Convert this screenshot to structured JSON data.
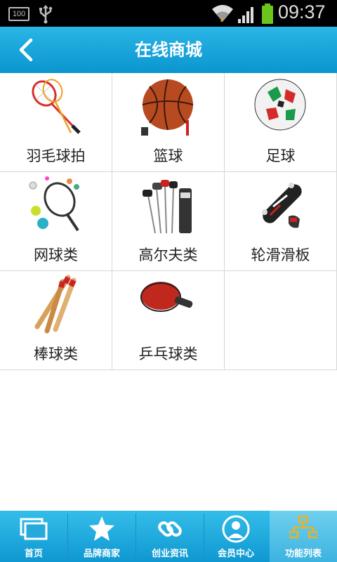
{
  "status_bar": {
    "battery_badge": "100",
    "time": "09:37",
    "icons": [
      "battery-100-icon",
      "usb-icon",
      "wifi-icon",
      "signal-icon",
      "battery-charging-icon"
    ]
  },
  "header": {
    "title": "在线商城",
    "back_icon": "back-arrow-icon"
  },
  "colors": {
    "header": "#13a1d8",
    "tabbar": "#1aa6dd",
    "tab_active": "#5cc6eb",
    "battery": "#6cc51b"
  },
  "categories": [
    {
      "label": "羽毛球拍",
      "icon": "badminton-racket-icon"
    },
    {
      "label": "篮球",
      "icon": "basketball-icon"
    },
    {
      "label": "足球",
      "icon": "soccer-ball-icon"
    },
    {
      "label": "网球类",
      "icon": "tennis-icon"
    },
    {
      "label": "高尔夫类",
      "icon": "golf-clubs-icon"
    },
    {
      "label": "轮滑滑板",
      "icon": "skateboard-icon"
    },
    {
      "label": "棒球类",
      "icon": "baseball-bat-icon"
    },
    {
      "label": "乒乓球类",
      "icon": "ping-pong-paddle-icon"
    }
  ],
  "tabbar": {
    "active_index": 4,
    "tabs": [
      {
        "label": "首页",
        "icon": "home-icon"
      },
      {
        "label": "品牌商家",
        "icon": "star-icon"
      },
      {
        "label": "创业资讯",
        "icon": "link-icon"
      },
      {
        "label": "会员中心",
        "icon": "member-icon"
      },
      {
        "label": "功能列表",
        "icon": "sitemap-icon"
      }
    ]
  }
}
